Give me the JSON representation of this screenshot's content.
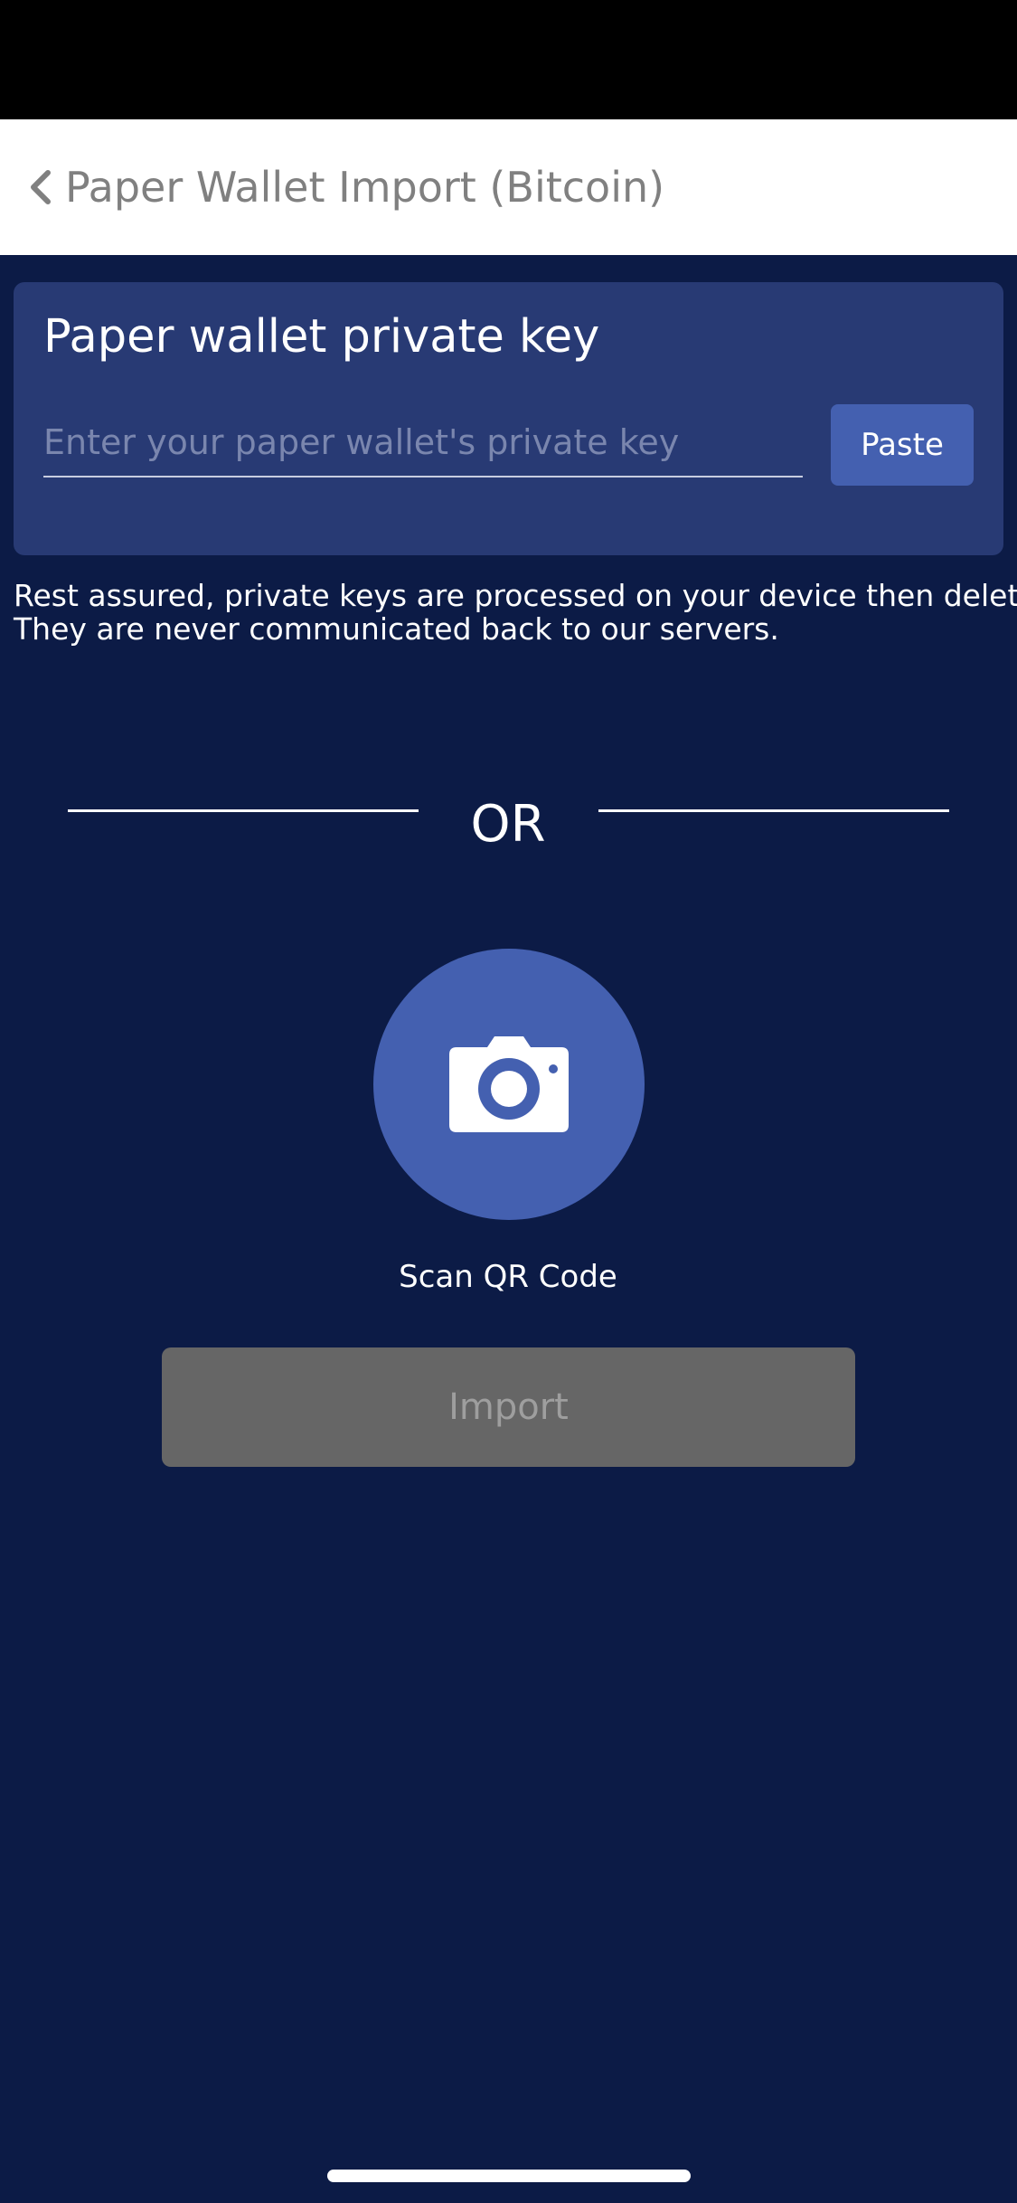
{
  "header": {
    "title": "Paper Wallet Import (Bitcoin)",
    "back_icon": "chevron-left-icon"
  },
  "key_card": {
    "title": "Paper wallet private key",
    "input_value": "",
    "input_placeholder": "Enter your paper wallet's private key",
    "paste_label": "Paste"
  },
  "notice": {
    "line1": "Rest assured, private keys are processed on your device then deleted.",
    "line2": "They are never communicated back to our servers."
  },
  "divider": {
    "label": "OR"
  },
  "scan": {
    "icon": "camera-icon",
    "label": "Scan QR Code"
  },
  "import": {
    "label": "Import",
    "state": "disabled"
  },
  "colors": {
    "background": "#0c1b46",
    "card": "#283a74",
    "accent": "#4460b0",
    "disabled_button": "#666666",
    "header_text": "#808080"
  }
}
